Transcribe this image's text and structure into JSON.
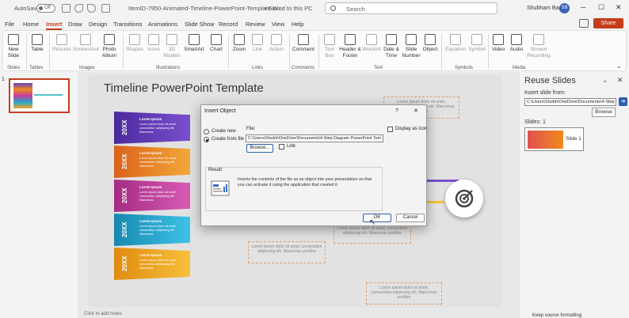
{
  "titlebar": {
    "autosave": "AutoSave",
    "toggle": "Off",
    "doc_title": "ItemID-7950-Animated-Timeline-PowerPoint-Template-W...",
    "saved": "• Saved to this PC",
    "search_placeholder": "Search",
    "user": "Shubham Bagul",
    "user_initials": "SB"
  },
  "tabs": [
    "File",
    "Home",
    "Insert",
    "Draw",
    "Design",
    "Transitions",
    "Animations",
    "Slide Show",
    "Record",
    "Review",
    "View",
    "Help"
  ],
  "share": "Share",
  "ribbon": {
    "new_slide": "New Slide",
    "table": "Table",
    "pictures": "Pictures",
    "screenshot": "Screenshot",
    "photo_album": "Photo Album",
    "shapes": "Shapes",
    "icons": "Icons",
    "models_3d": "3D Models",
    "smartart": "SmartArt",
    "chart": "Chart",
    "zoom": "Zoom",
    "link": "Link",
    "action": "Action",
    "comment": "Comment",
    "text_box": "Text Box",
    "header_footer": "Header & Footer",
    "wordart": "WordArt",
    "date_time": "Date & Time",
    "slide_number": "Slide Number",
    "object": "Object",
    "equation": "Equation",
    "symbol": "Symbol",
    "video": "Video",
    "audio": "Audio",
    "screen_recording": "Screen Recording",
    "groups": {
      "slides": "Slides",
      "tables": "Tables",
      "images": "Images",
      "illustrations": "Illustrations",
      "links": "Links",
      "comments": "Comments",
      "text": "Text",
      "symbols": "Symbols",
      "media": "Media"
    }
  },
  "thumbs": {
    "number": "1"
  },
  "slide": {
    "title": "Timeline PowerPoint Template",
    "band_year": "20XX",
    "band_title": "Lorem Ipsum",
    "band_desc": "Lorem ipsum dolor sit amet, consectetur adipiscing elit. Maecenas",
    "box_text": "Lorem ipsum dolor sit amet, consectetur adipiscing elit. Maecenas porttitor",
    "colors": [
      "#6a3fc1",
      "#f08a1c",
      "#c63d9e",
      "#21a7d0",
      "#f5a623"
    ]
  },
  "reuse": {
    "title": "Reuse Slides",
    "insert_from": "Insert slide from:",
    "path": "C:\\Users\\Shubh\\OneDrive\\Documents\\4-Step",
    "browse": "Browse",
    "slides_label": "Slides: 1",
    "slide1": "Slide 1",
    "keep_format": "Keep source formatting"
  },
  "dialog": {
    "title": "Insert Object",
    "help": "?",
    "close": "✕",
    "create_new": "Create new",
    "create_from_file": "Create from file",
    "file_label": "File:",
    "file_path": "C:\\Users\\Shubh\\OneDrive\\Documents\\4-Step Diagram PowerPoint Tem",
    "browse": "Browse...",
    "link": "Link",
    "display_icon": "Display as icon",
    "result_label": "Result",
    "result_text": "Inserts the contents of the file as an object into your presentation so that you can activate it using the application that created it.",
    "ok": "OK",
    "cancel": "Cancel"
  },
  "status": {
    "notes": "Click to add notes"
  }
}
